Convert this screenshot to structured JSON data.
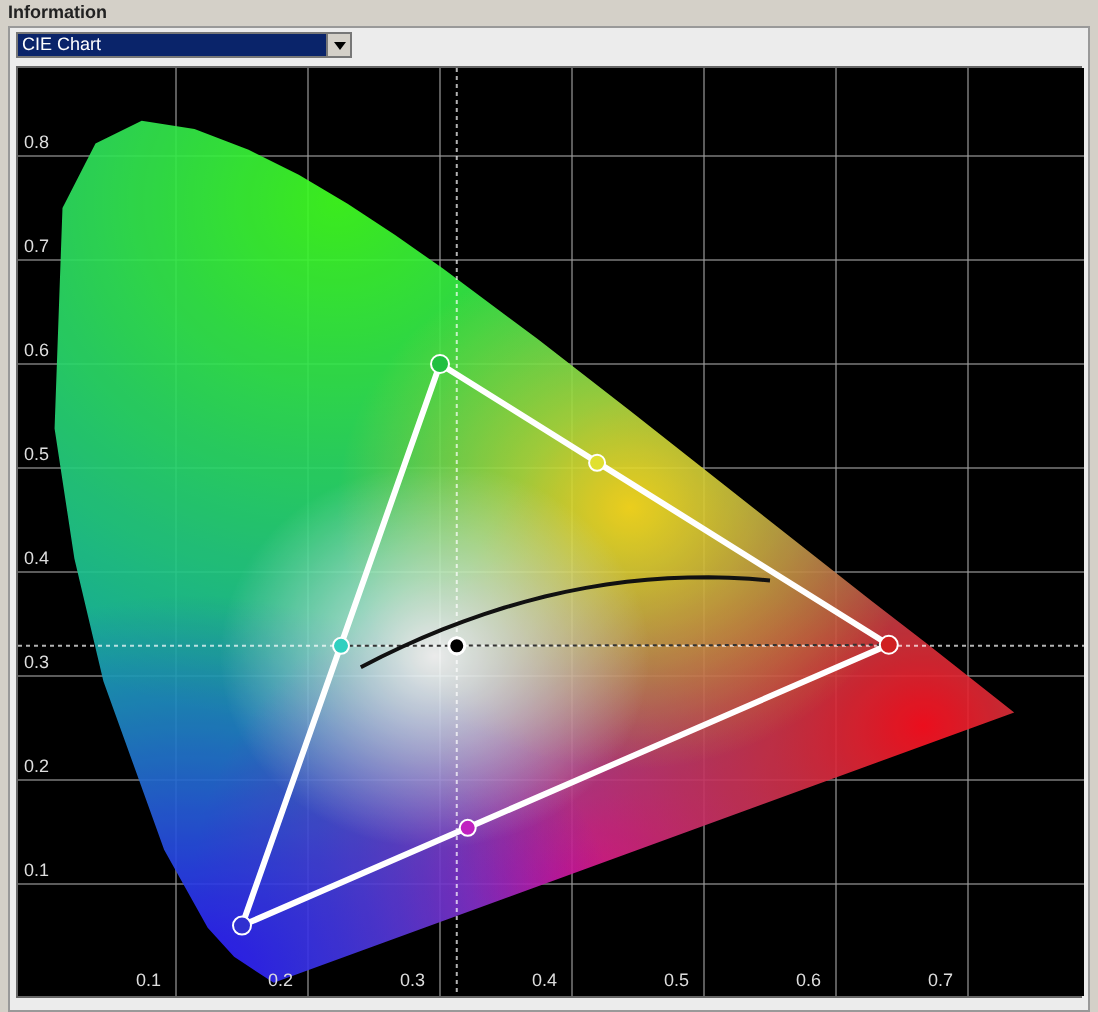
{
  "panel": {
    "title": "Information"
  },
  "view_select": {
    "value": "CIE Chart"
  },
  "chart": {
    "x_axis_labels": [
      "0.1",
      "0.2",
      "0.3",
      "0.4",
      "0.5",
      "0.6",
      "0.7"
    ],
    "y_axis_labels": [
      "0.8",
      "0.7",
      "0.6",
      "0.5",
      "0.4",
      "0.3",
      "0.2",
      "0.1"
    ]
  }
}
